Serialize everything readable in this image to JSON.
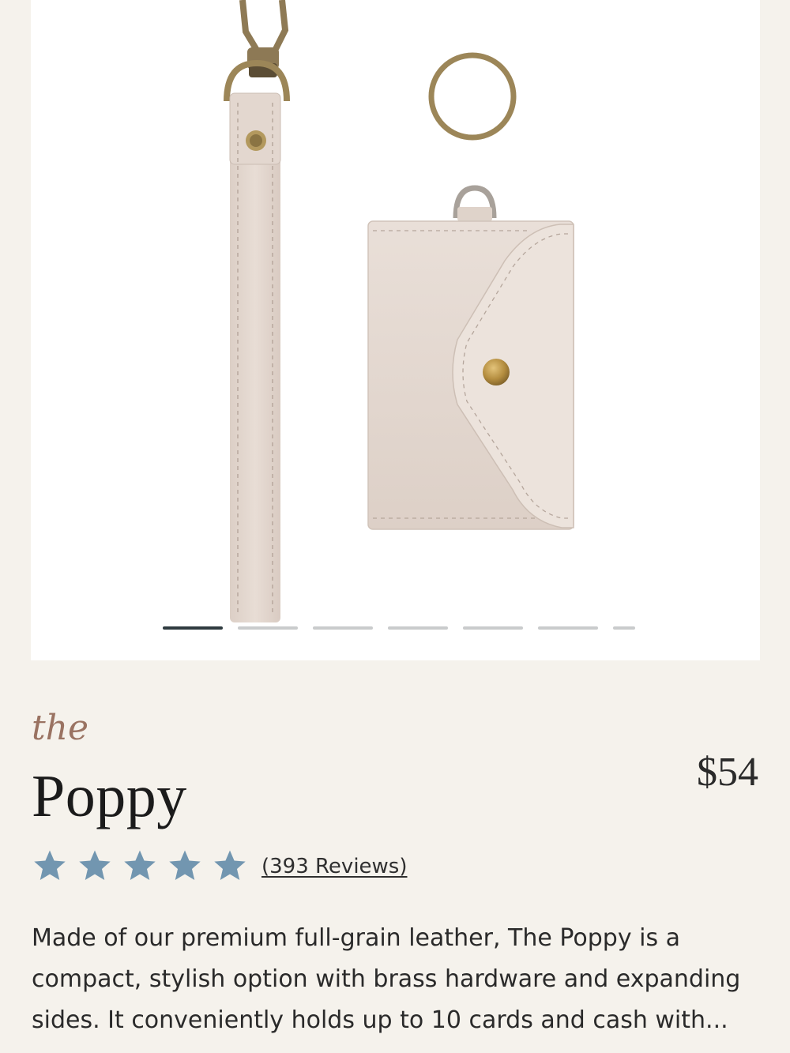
{
  "product": {
    "eyebrow": "the",
    "name": "Poppy",
    "price": "$54",
    "rating": 5,
    "reviews_label": "(393 Reviews)",
    "description": "Made of our premium full-grain leather, The Poppy is a compact, stylish option with brass hardware and expanding sides. It conveniently holds up to 10 cards and cash with..."
  },
  "gallery": {
    "slide_count": 7,
    "active_index": 0,
    "image_label": "product-photo-wristlet-and-card-wallet"
  },
  "colors": {
    "background": "#f5f2ec",
    "accent_eyebrow": "#9a7362",
    "star": "#7296b0",
    "leather": "#e6dad2",
    "brass": "#9c8658",
    "indicator_active": "#2f3b40",
    "indicator_inactive": "#c9cbcc"
  },
  "icons": {
    "star": "star-icon"
  }
}
